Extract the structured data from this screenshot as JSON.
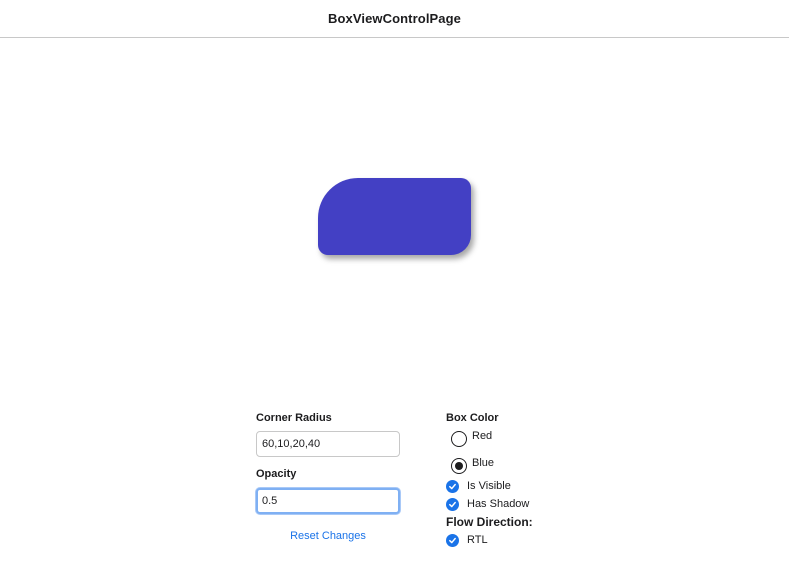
{
  "window": {
    "title": "BoxViewControlPage"
  },
  "box": {
    "color": "#4340c4",
    "opacity": 0.5
  },
  "controls": {
    "corner_radius": {
      "label": "Corner Radius",
      "value": "60,10,20,40"
    },
    "opacity": {
      "label": "Opacity",
      "value": "0.5"
    },
    "reset_label": "Reset Changes",
    "box_color": {
      "label": "Box Color",
      "options": [
        {
          "label": "Red",
          "selected": false
        },
        {
          "label": "Blue",
          "selected": true
        }
      ]
    },
    "is_visible": {
      "label": "Is Visible",
      "checked": true
    },
    "has_shadow": {
      "label": "Has Shadow",
      "checked": true
    },
    "flow_direction": {
      "label": "Flow Direction:"
    },
    "rtl": {
      "label": "RTL",
      "checked": true
    }
  },
  "colors": {
    "accent": "#1a73e8",
    "box": "#4340c4"
  }
}
